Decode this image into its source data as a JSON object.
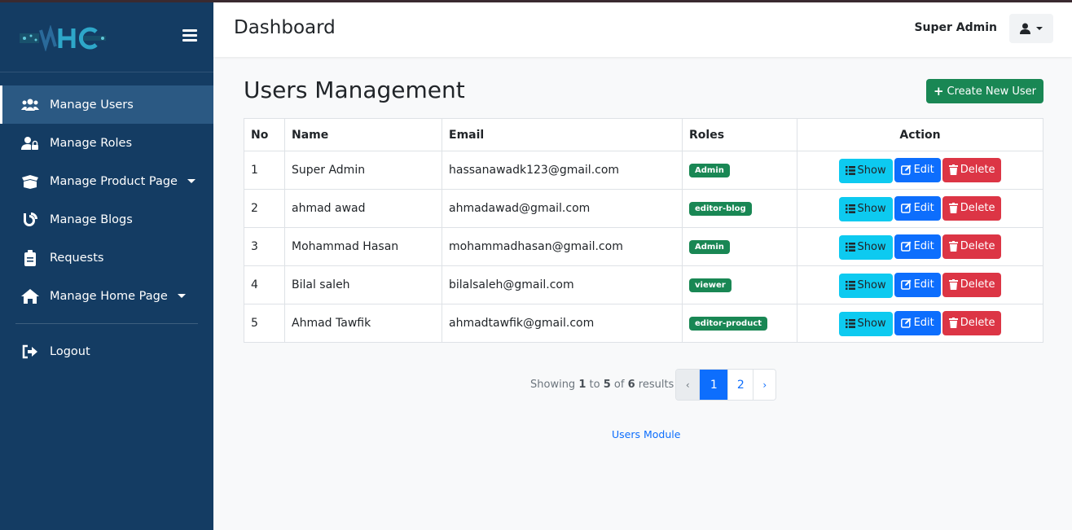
{
  "app": {
    "logo_text": "IVHC"
  },
  "sidebar": {
    "items": [
      {
        "label": "Manage Users",
        "icon": "users-icon",
        "active": true,
        "dropdown": false
      },
      {
        "label": "Manage Roles",
        "icon": "user-lock-icon",
        "active": false,
        "dropdown": false
      },
      {
        "label": "Manage Product Page",
        "icon": "box-open-icon",
        "active": false,
        "dropdown": true
      },
      {
        "label": "Manage Blogs",
        "icon": "blog-icon",
        "active": false,
        "dropdown": false
      },
      {
        "label": "Requests",
        "icon": "clipboard-icon",
        "active": false,
        "dropdown": false
      },
      {
        "label": "Manage Home Page",
        "icon": "home-icon",
        "active": false,
        "dropdown": true
      }
    ],
    "logout": "Logout"
  },
  "header": {
    "title": "Dashboard",
    "user_name": "Super Admin"
  },
  "main": {
    "title": "Users Management",
    "create_button": "Create New User",
    "table": {
      "headers": [
        "No",
        "Name",
        "Email",
        "Roles",
        "Action"
      ],
      "rows": [
        {
          "no": "1",
          "name": "Super Admin",
          "email": "hassanawadk123@gmail.com",
          "role": "Admin"
        },
        {
          "no": "2",
          "name": "ahmad awad",
          "email": "ahmadawad@gmail.com",
          "role": "editor-blog"
        },
        {
          "no": "3",
          "name": "Mohammad Hasan",
          "email": "mohammadhasan@gmail.com",
          "role": "Admin"
        },
        {
          "no": "4",
          "name": "Bilal saleh",
          "email": "bilalsaleh@gmail.com",
          "role": "viewer"
        },
        {
          "no": "5",
          "name": "Ahmad Tawfik",
          "email": "ahmadtawfik@gmail.com",
          "role": "editor-product"
        }
      ],
      "actions": {
        "show": "Show",
        "edit": "Edit",
        "delete": "Delete"
      }
    },
    "pagination": {
      "showing": "Showing",
      "from": "1",
      "to_word": "to",
      "to": "5",
      "of_word": "of",
      "total": "6",
      "results": "results",
      "prev": "‹",
      "pages": [
        "1",
        "2"
      ],
      "next": "›",
      "current": "1"
    },
    "footer_link": "Users Module"
  },
  "colors": {
    "sidebar": "#143c63",
    "accent": "#0d6efd",
    "success": "#198754",
    "info": "#0dcaf0",
    "danger": "#dc3545"
  }
}
